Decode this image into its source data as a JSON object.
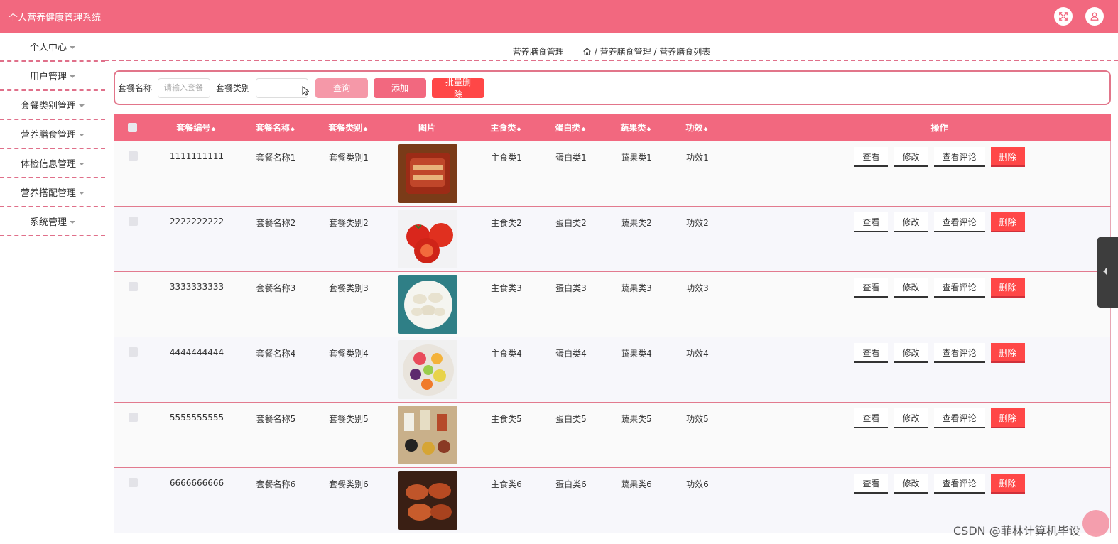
{
  "header": {
    "title": "个人营养健康管理系统"
  },
  "sidebar": {
    "items": [
      {
        "label": "个人中心"
      },
      {
        "label": "用户管理"
      },
      {
        "label": "套餐类别管理"
      },
      {
        "label": "营养膳食管理"
      },
      {
        "label": "体检信息管理"
      },
      {
        "label": "营养搭配管理"
      },
      {
        "label": "系统管理"
      }
    ]
  },
  "breadcrumb": {
    "page": "营养膳食管理",
    "path": "/ 营养膳食管理 / 营养膳食列表"
  },
  "search": {
    "name_label": "套餐名称",
    "name_placeholder": "请输入套餐",
    "type_label": "套餐类别",
    "query_label": "查询",
    "add_label": "添加",
    "batch_delete_label": "批量删除"
  },
  "table": {
    "headers": {
      "code": "套餐编号",
      "name": "套餐名称",
      "type": "套餐类别",
      "image": "图片",
      "staple": "主食类",
      "protein": "蛋白类",
      "fruit": "蔬果类",
      "effect": "功效",
      "ops": "操作"
    },
    "rows": [
      {
        "code": "1111111111",
        "name": "套餐名称1",
        "type": "套餐类别1",
        "staple": "主食类1",
        "protein": "蛋白类1",
        "fruit": "蔬果类1",
        "effect": "功效1"
      },
      {
        "code": "2222222222",
        "name": "套餐名称2",
        "type": "套餐类别2",
        "staple": "主食类2",
        "protein": "蛋白类2",
        "fruit": "蔬果类2",
        "effect": "功效2"
      },
      {
        "code": "3333333333",
        "name": "套餐名称3",
        "type": "套餐类别3",
        "staple": "主食类3",
        "protein": "蛋白类3",
        "fruit": "蔬果类3",
        "effect": "功效3"
      },
      {
        "code": "4444444444",
        "name": "套餐名称4",
        "type": "套餐类别4",
        "staple": "主食类4",
        "protein": "蛋白类4",
        "fruit": "蔬果类4",
        "effect": "功效4"
      },
      {
        "code": "5555555555",
        "name": "套餐名称5",
        "type": "套餐类别5",
        "staple": "主食类5",
        "protein": "蛋白类5",
        "fruit": "蔬果类5",
        "effect": "功效5"
      },
      {
        "code": "6666666666",
        "name": "套餐名称6",
        "type": "套餐类别6",
        "staple": "主食类6",
        "protein": "蛋白类6",
        "fruit": "蔬果类6",
        "effect": "功效6"
      }
    ],
    "ops": {
      "view": "查看",
      "edit": "修改",
      "comments": "查看评论",
      "delete": "删除"
    }
  },
  "watermark": "CSDN @菲林计算机毕设",
  "colors": {
    "primary": "#f2687f",
    "danger": "#ff4747",
    "light": "#f598a8"
  }
}
